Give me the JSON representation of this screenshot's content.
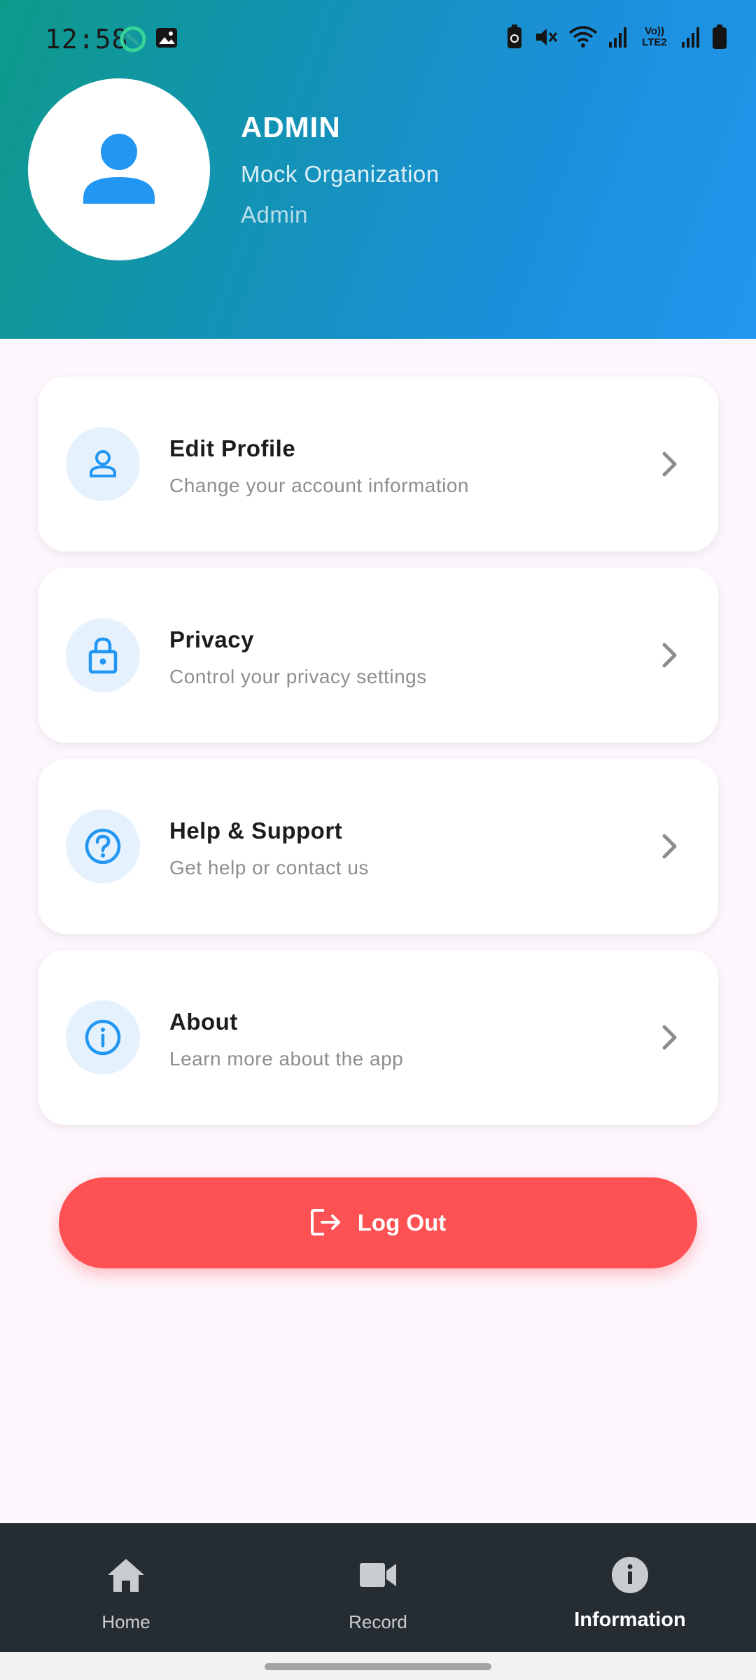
{
  "status_bar": {
    "time": "12:58",
    "network_label": "Vo)) LTE2",
    "icons": [
      "sync-icon",
      "gallery-icon",
      "battery-saver-icon",
      "mute-icon",
      "wifi-icon",
      "signal-icon",
      "signal-icon",
      "battery-icon"
    ]
  },
  "profile": {
    "name": "ADMIN",
    "organization": "Mock Organization",
    "role": "Admin",
    "avatar_icon": "person-icon"
  },
  "menu": {
    "items": [
      {
        "title": "Edit Profile",
        "subtitle": "Change your account information",
        "icon": "person-outline-icon"
      },
      {
        "title": "Privacy",
        "subtitle": "Control your privacy settings",
        "icon": "lock-icon"
      },
      {
        "title": "Help & Support",
        "subtitle": "Get help or contact us",
        "icon": "help-circle-icon"
      },
      {
        "title": "About",
        "subtitle": "Learn more about the app",
        "icon": "info-circle-icon"
      }
    ]
  },
  "logout": {
    "label": "Log Out",
    "icon": "logout-icon"
  },
  "bottom_nav": {
    "items": [
      {
        "label": "Home",
        "icon": "home-icon",
        "active": false
      },
      {
        "label": "Record",
        "icon": "videocam-icon",
        "active": false
      },
      {
        "label": "Information",
        "icon": "info-icon",
        "active": true
      }
    ]
  },
  "colors": {
    "accent": "#2196f3",
    "logout": "#fd5154",
    "nav_background": "#252d33",
    "page_background": "#fdf6fc"
  }
}
